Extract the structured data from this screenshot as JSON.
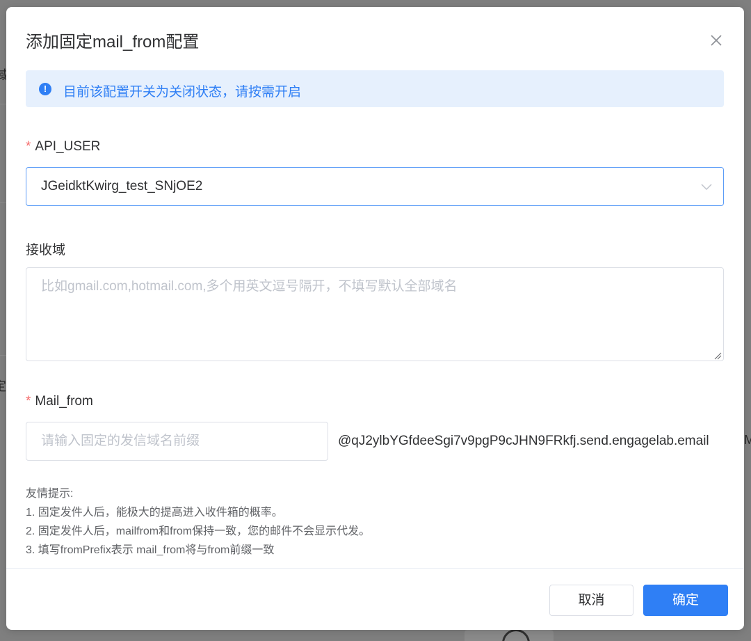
{
  "dialog": {
    "title": "添加固定mail_from配置",
    "close_icon": "close-icon"
  },
  "alert": {
    "icon": "info-circle-icon",
    "text": "目前该配置开关为关闭状态，请按需开启"
  },
  "form": {
    "api_user": {
      "label": "API_USER",
      "required": true,
      "value": "JGeidktKwirg_test_SNjOE2",
      "arrow_icon": "chevron-down-icon"
    },
    "receive_domain": {
      "label": "接收域",
      "placeholder": "比如gmail.com,hotmail.com,多个用英文逗号隔开，不填写默认全部域名",
      "value": ""
    },
    "mail_from": {
      "label": "Mail_from",
      "required": true,
      "placeholder": "请输入固定的发信域名前缀",
      "value": "",
      "suffix": "@qJ2ylbYGfdeeSgi7v9pgP9cJHN9FRkfj.send.engagelab.email"
    },
    "required_mark": "*"
  },
  "tips": {
    "heading": "友情提示:",
    "lines": [
      "1. 固定发件人后，能极大的提高进入收件箱的概率。",
      "2. 固定发件人后，mailfrom和from保持一致，您的邮件不会显示代发。",
      "3. 填写fromPrefix表示 mail_from将与from前缀一致"
    ]
  },
  "footer": {
    "cancel_label": "取消",
    "confirm_label": "确定"
  },
  "background": {
    "frag_1": "域",
    "frag_2": "定",
    "frag_3": "Ma"
  },
  "colors": {
    "primary": "#2f7ff5",
    "alert_bg": "#e6f0fd",
    "required": "#f56c6c",
    "placeholder": "#c0c4cc"
  }
}
